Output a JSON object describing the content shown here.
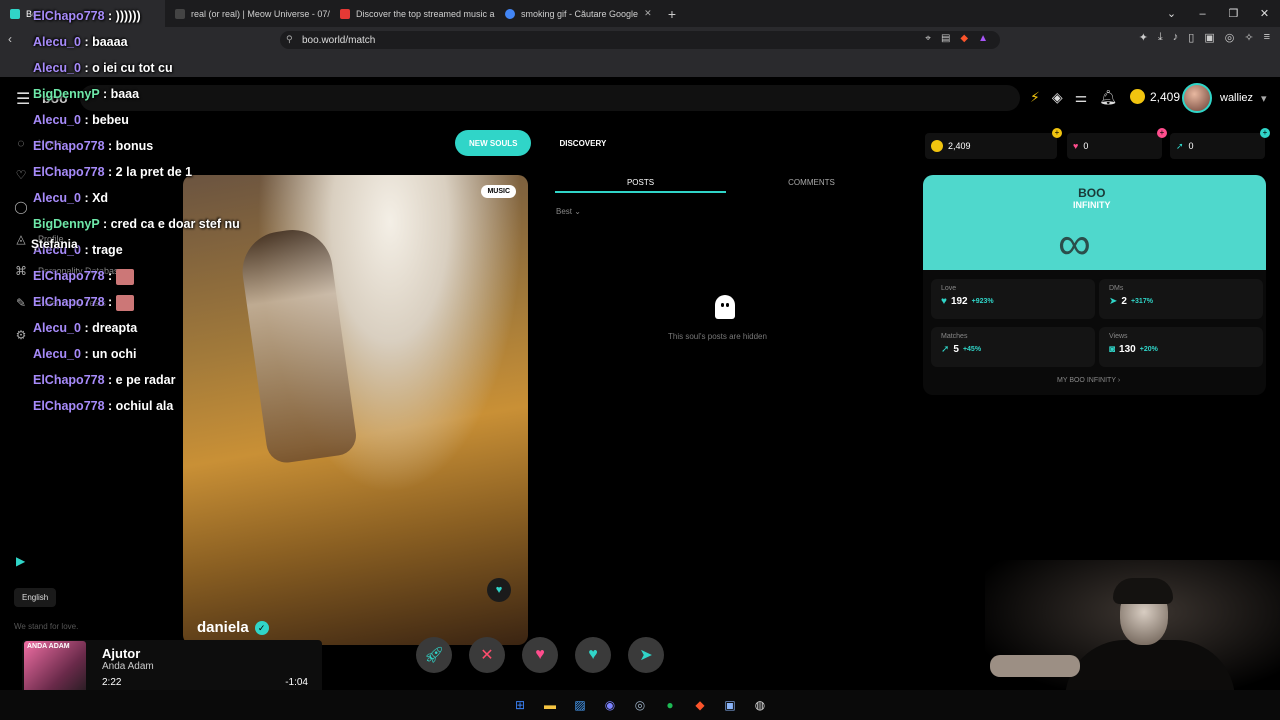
{
  "browser": {
    "tabs": [
      {
        "title": "Bo",
        "active": true,
        "color": "#30d5c8"
      },
      {
        "title": "real (or real) | Meow Universe - 07/2...",
        "active": false,
        "color": "#444444"
      },
      {
        "title": "Discover the top streamed music and ...",
        "active": false,
        "color": "#e53935"
      },
      {
        "title": "smoking gif - Căutare Google",
        "active": false,
        "color": "#4285f4"
      }
    ],
    "url": "boo.world/match"
  },
  "app": {
    "logo": "boo",
    "coins": "2,409",
    "username": "walliez",
    "menu": [
      {
        "label": "Home",
        "icon": "◌"
      },
      {
        "label": "Profile",
        "icon": "♡"
      },
      {
        "label": "Messages",
        "icon": "◯"
      },
      {
        "label": "Profile",
        "icon": "♫"
      },
      {
        "label": "Personality Database",
        "icon": "⌘"
      },
      {
        "label": "Personality Tests",
        "icon": "✎"
      },
      {
        "label": "Settings",
        "icon": "⚙"
      }
    ],
    "menu_labels": {
      "home": "Home",
      "profile": "Profile",
      "pdb": "Personality Database",
      "tests": "Personality Tests"
    },
    "tabs": {
      "new_souls": "NEW SOULS",
      "discovery": "DISCOVERY"
    },
    "language": "English",
    "footer": "We stand for love.",
    "card": {
      "badge": "MUSIC",
      "name": "daniela"
    },
    "posts": {
      "tab_posts": "POSTS",
      "tab_comments": "COMMENTS",
      "sort": "Best",
      "hidden_text": "This soul's posts are hidden"
    },
    "top_stats": {
      "coins": "2,409",
      "love": "0",
      "boosts": "0"
    },
    "infinity": {
      "title": "BOO",
      "subtitle": "INFINITY",
      "link": "MY BOO INFINITY",
      "stats": {
        "love": {
          "label": "Love",
          "value": "192",
          "delta": "+923%"
        },
        "dms": {
          "label": "DMs",
          "value": "2",
          "delta": "+317%"
        },
        "matches": {
          "label": "Matches",
          "value": "5",
          "delta": "+45%"
        },
        "views": {
          "label": "Views",
          "value": "130",
          "delta": "+20%"
        }
      }
    }
  },
  "chat": {
    "lines": [
      {
        "user": "ElChapo778",
        "msg": ": ))))))",
        "color": "u1"
      },
      {
        "user": "Alecu_0",
        "msg": ": baaaa",
        "color": "u1"
      },
      {
        "user": "Alecu_0",
        "msg": ": o iei cu tot cu",
        "color": "u1"
      },
      {
        "user": "BigDennyP",
        "msg": ": baaa",
        "color": "u2"
      },
      {
        "user": "Alecu_0",
        "msg": ": bebeu",
        "color": "u1"
      },
      {
        "user": "ElChapo778",
        "msg": ": bonus",
        "color": "u1"
      },
      {
        "user": "ElChapo778",
        "msg": ": 2 la pret de 1",
        "color": "u1"
      },
      {
        "user": "Alecu_0",
        "msg": ": Xd",
        "color": "u1"
      },
      {
        "user": "BigDennyP",
        "msg": ": cred ca e doar stef nu",
        "color": "u2"
      },
      {
        "user": "Alecu_0",
        "msg": ": trage",
        "color": "u1"
      },
      {
        "user": "ElChapo778",
        "msg": ":",
        "color": "u1",
        "emote": true
      },
      {
        "user": "ElChapo778",
        "msg": ":",
        "color": "u1",
        "emote": true
      },
      {
        "user": "Alecu_0",
        "msg": ": dreapta",
        "color": "u1"
      },
      {
        "user": "Alecu_0",
        "msg": ": un ochi",
        "color": "u1"
      },
      {
        "user": "ElChapo778",
        "msg": ": e pe radar",
        "color": "u1"
      },
      {
        "user": "ElChapo778",
        "msg": ": ochiul ala",
        "color": "u1"
      }
    ],
    "wrap": "Ștefania"
  },
  "nowplaying": {
    "art_text": "ANDA ADAM",
    "title": "Ajutor",
    "artist": "Anda Adam",
    "elapsed": "2:22",
    "remaining": "-1:04",
    "progress": 0.69
  },
  "colors": {
    "accent": "#30d5c8",
    "pink": "#ff4d8d"
  }
}
